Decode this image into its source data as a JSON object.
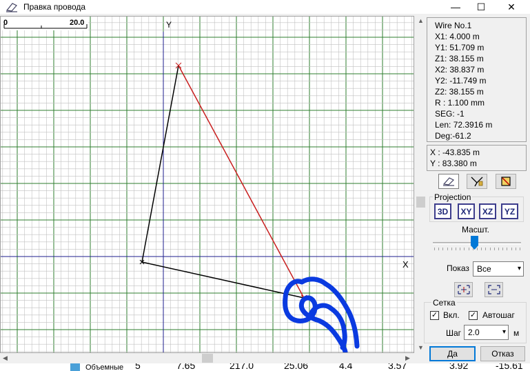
{
  "window": {
    "title": "Правка провода",
    "minimize": "—",
    "maximize": "☐",
    "close": "✕"
  },
  "ruler": {
    "start": "0",
    "end": "20.0"
  },
  "axes": {
    "y_label": "Y",
    "x_label": "X"
  },
  "wire_info": [
    "Wire No.1",
    "X1: 4.000 m",
    "Y1: 51.709 m",
    "Z1: 38.155 m",
    "X2: 38.837 m",
    "Y2: -11.749 m",
    "Z2: 38.155 m",
    "R : 1.100 mm",
    "SEG: -1",
    "Len: 72.3916 m",
    "Deg:-61.2"
  ],
  "cursor": {
    "x": "X : -43.835 m",
    "y": "Y : 83.380 m"
  },
  "tools": [
    "eraser-tool-icon",
    "wire-draw-tool-icon",
    "box-select-tool-icon"
  ],
  "projection": {
    "label": "Projection",
    "buttons": [
      "3D",
      "XY",
      "XZ",
      "YZ"
    ]
  },
  "scale": {
    "label": "Масшт.",
    "level": 0.47
  },
  "show": {
    "label": "Показ",
    "value": "Все"
  },
  "grid": {
    "label": "Сетка",
    "enabled_label": "Вкл.",
    "enabled": true,
    "autostep_label": "Автошаг",
    "autostep": true,
    "step_label": "Шаг",
    "step_value": "2.0",
    "unit": "м"
  },
  "buttons": {
    "ok": "Да",
    "cancel": "Отказ"
  },
  "background_table": {
    "label": "Объемные",
    "cells": [
      "5",
      "7.65",
      "217.0",
      "25.06",
      "4.4",
      "3.57",
      "3.92",
      "-15.61"
    ]
  },
  "colors": {
    "grid_minor": "#c0c0c0",
    "grid_major": "#2e7d2e",
    "axis": "#1e1e8c",
    "selected_wire": "#c81e1e",
    "wire": "#000000",
    "annotation": "#0a3ae0",
    "accent": "#0078d7"
  }
}
